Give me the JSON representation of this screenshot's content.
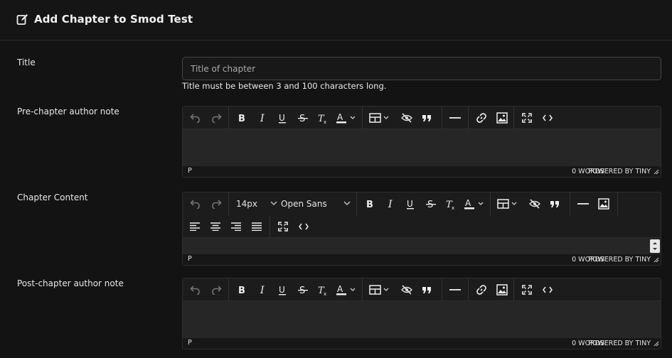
{
  "header": {
    "title": "Add Chapter to Smod Test",
    "icon": "edit-icon"
  },
  "fields": {
    "title_label": "Title",
    "title_placeholder": "Title of chapter",
    "title_hint": "Title must be between 3 and 100 characters long.",
    "pre_label": "Pre-chapter author note",
    "content_label": "Chapter Content",
    "post_label": "Post-chapter author note"
  },
  "editors": {
    "pre": {
      "status_tag": "P",
      "word_count": "0 WORDS",
      "powered": "POWERED BY TINY"
    },
    "content": {
      "status_tag": "P",
      "word_count": "0 WORDS",
      "powered": "POWERED BY TINY",
      "font_size": "14px",
      "font_family": "Open Sans"
    },
    "post": {
      "status_tag": "P",
      "word_count": "0 WORDS",
      "powered": "POWERED BY TINY"
    }
  },
  "colors": {
    "background": "#131313",
    "editor_area": "#262626",
    "text": "#e6e6e6"
  }
}
